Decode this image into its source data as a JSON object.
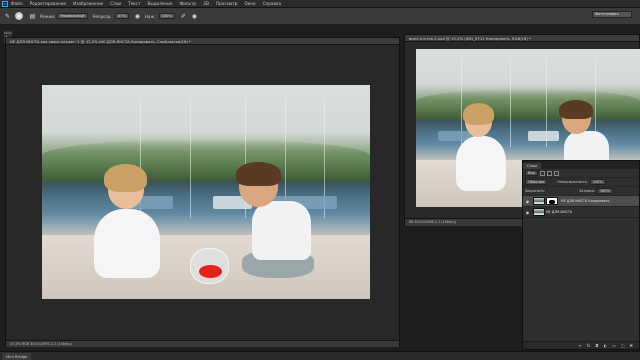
{
  "app": {
    "logo": "Ps",
    "menu": [
      "Файл",
      "Редактирование",
      "Изображение",
      "Слои",
      "Текст",
      "Выделение",
      "Фильтр",
      "3D",
      "Просмотр",
      "Окно",
      "Справка"
    ]
  },
  "options_bar": {
    "mode_label": "Режим:",
    "mode_value": "Нормальный",
    "opacity_label": "Непрозр.:",
    "opacity_value": "47%",
    "flow_label": "Наж.:",
    "flow_value": "100%",
    "workspace": "Фотография"
  },
  "documents": [
    {
      "tab": "НЕ ДЛЯ ИНСТА как сверт-отъем~1 @ 47,2% (НЕ ДЛЯ ИНСТА Копировать, Слой-маска/16) *",
      "status": "47,2%      RGB 3015x2095-2,1 (14bit/ц)"
    },
    {
      "tab": "вреч-ктсток-1.psd @ 15,2% (IMG_9711 Копировать, RGB/16) *",
      "status": "68 3015x2066-2,1 (16bit/ц)"
    }
  ],
  "layers_panel": {
    "tab": "Слои",
    "kind": "Вид",
    "blend": "Обычные",
    "opacity_label": "Непрозрачность:",
    "opacity_value": "100%",
    "lock_label": "Закрепить:",
    "fill_label": "Заливка:",
    "fill_value": "100%",
    "layers": [
      {
        "name": "НЕ ДЛЯ ИНСТА Копировать",
        "active": true
      },
      {
        "name": "НЕ ДЛЯ ИНСТА",
        "active": false
      }
    ]
  },
  "bottom_panel": {
    "tab": "Mini Bridge"
  }
}
